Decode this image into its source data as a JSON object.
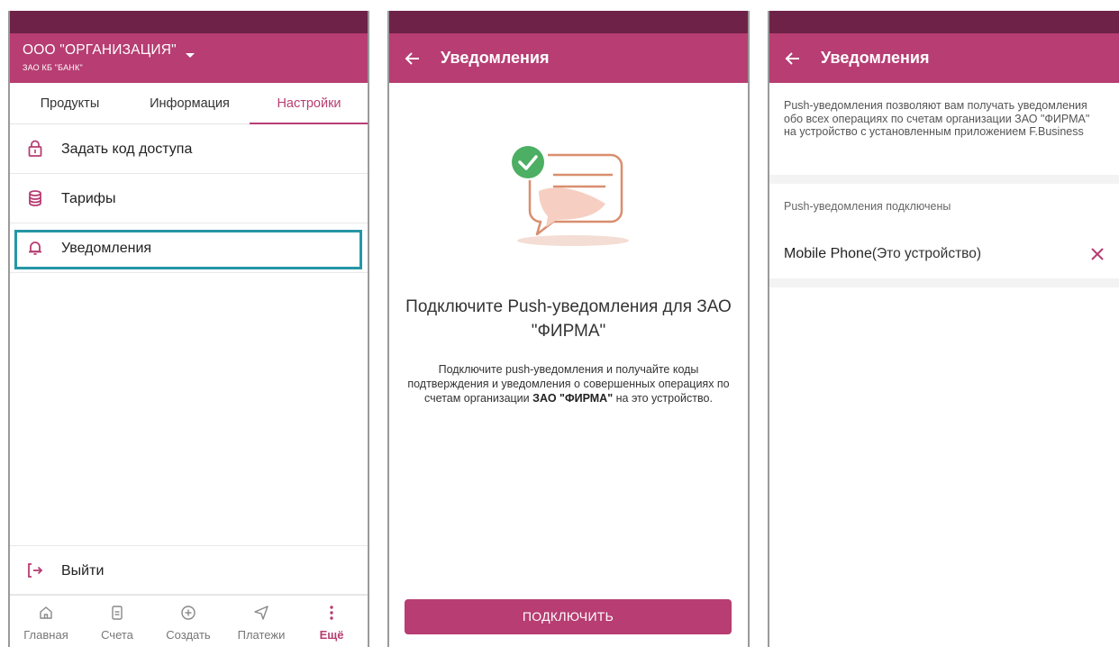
{
  "colors": {
    "accent": "#b73d72",
    "statusbar": "#6f2248",
    "highlight": "#2696a6"
  },
  "screen1": {
    "org_name": "ООО \"ОРГАНИЗАЦИЯ\"",
    "bank_name": "ЗАО КБ \"БАНК\"",
    "tabs": [
      {
        "label": "Продукты"
      },
      {
        "label": "Информация"
      },
      {
        "label": "Настройки",
        "active": true
      }
    ],
    "menu": [
      {
        "label": "Задать код доступа",
        "icon": "lock-icon"
      },
      {
        "label": "Тарифы",
        "icon": "database-icon"
      },
      {
        "label": "Уведомления",
        "icon": "bell-icon"
      }
    ],
    "logout_label": "Выйти",
    "bottom_nav": [
      {
        "label": "Главная",
        "icon": "home-icon"
      },
      {
        "label": "Счета",
        "icon": "document-icon"
      },
      {
        "label": "Создать",
        "icon": "plus-circle-icon"
      },
      {
        "label": "Платежи",
        "icon": "send-icon"
      },
      {
        "label": "Ещё",
        "icon": "more-vertical-icon",
        "active": true
      }
    ]
  },
  "screen2": {
    "title": "Уведомления",
    "headline": "Подключите Push-уведомления для ЗАО \"ФИРМА\"",
    "description_part1": "Подключите push-уведомления и получайте коды подтверждения и уведомления о совершенных операциях по счетам организации ",
    "description_org": "ЗАО \"ФИРМА\"",
    "description_part2": " на это устройство.",
    "button_label": "ПОДКЛЮЧИТЬ"
  },
  "screen3": {
    "title": "Уведомления",
    "info": "Push-уведомления позволяют вам получать уведомления обо всех операциях по счетам организации ЗАО \"ФИРМА\" на устройство с установленным приложением F.Business",
    "section_label": "Push-уведомления подключены",
    "device_name": "Mobile Phone",
    "device_note": "(Это устройство)"
  }
}
